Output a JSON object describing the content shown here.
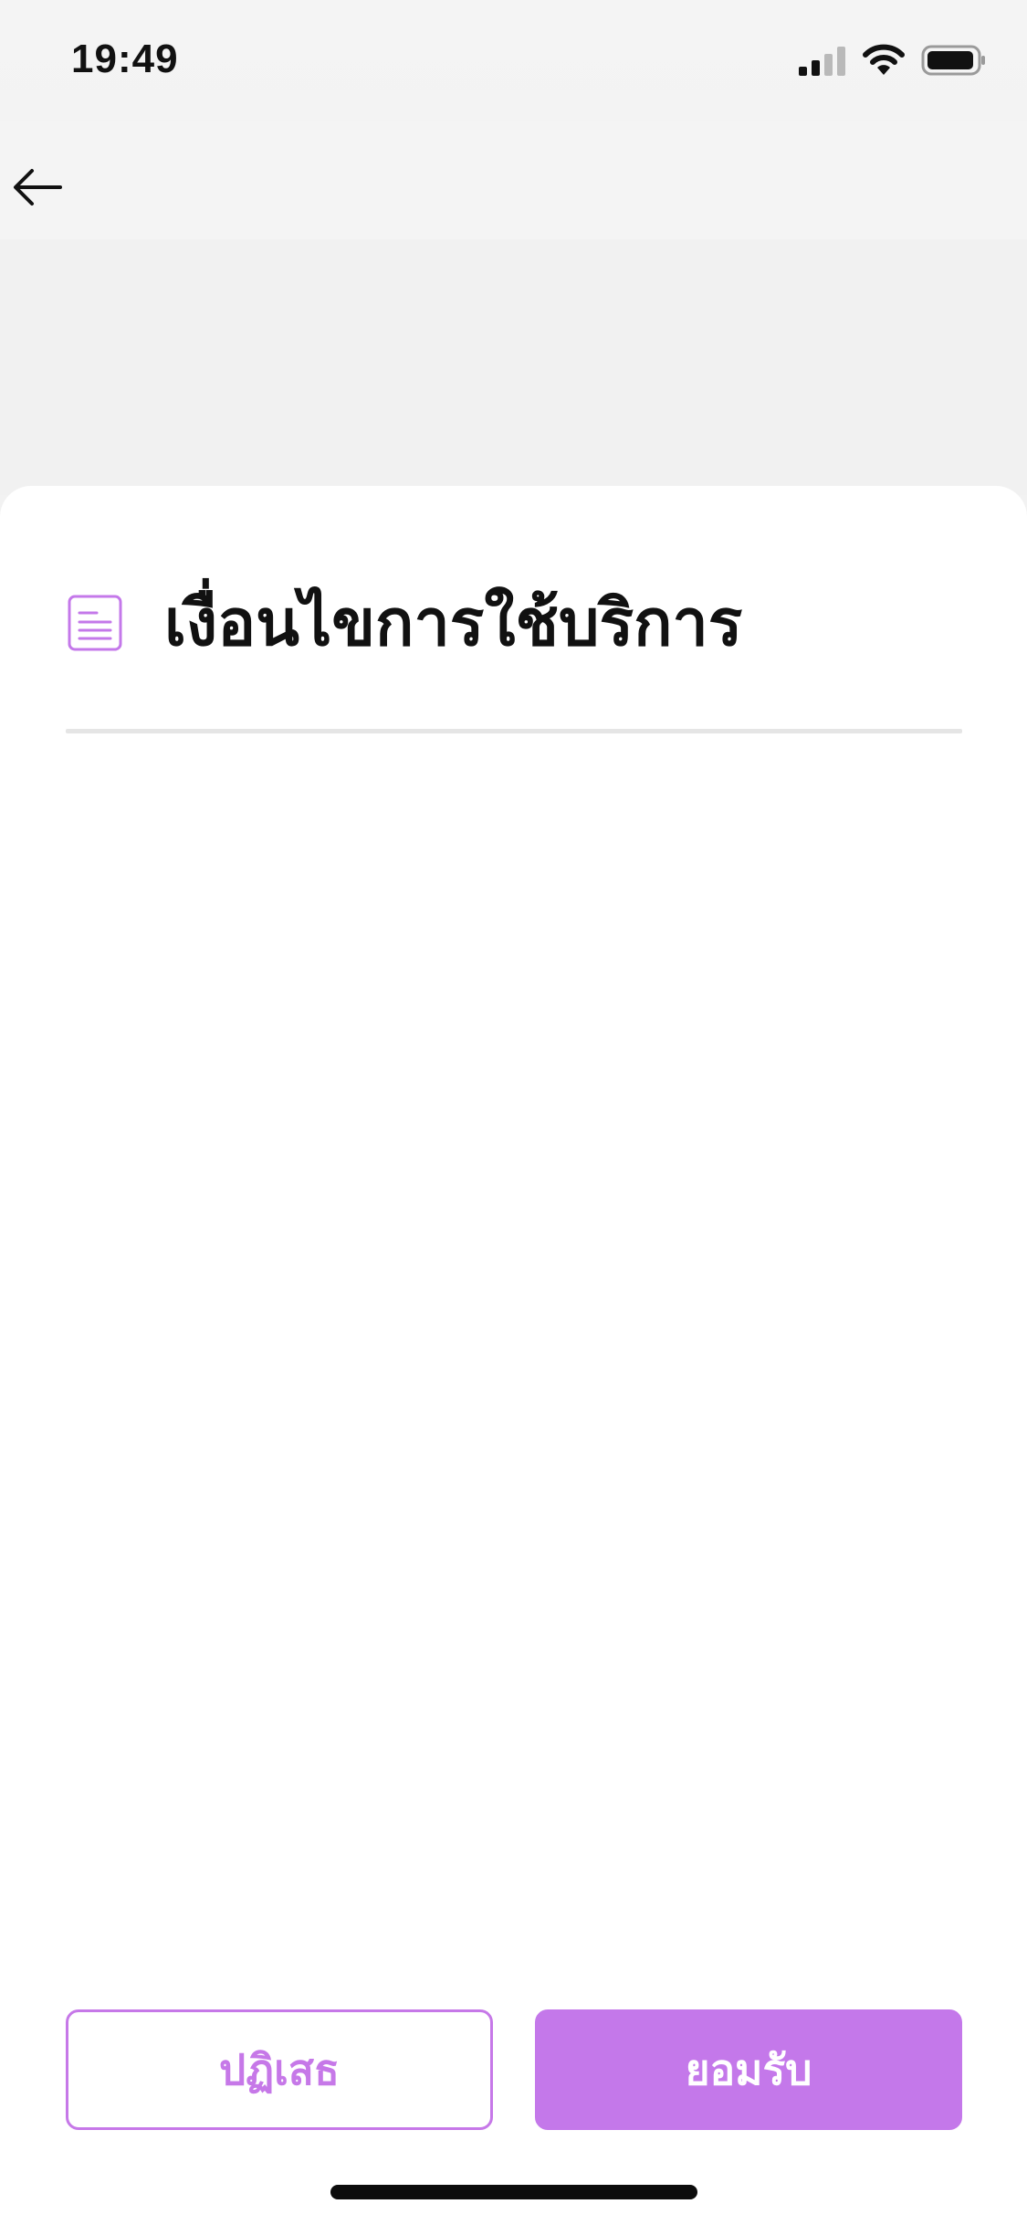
{
  "status_bar": {
    "time": "19:49",
    "signal_icon": "cellular-signal-icon",
    "wifi_icon": "wifi-icon",
    "battery_icon": "battery-icon"
  },
  "nav": {
    "back_icon": "arrow-left-icon"
  },
  "sheet": {
    "icon": "document-icon",
    "title": "เงื่อนไขการใช้บริการ"
  },
  "actions": {
    "decline_label": "ปฏิเสธ",
    "accept_label": "ยอมรับ"
  },
  "colors": {
    "accent": "#c478ea",
    "background": "#f2f2f2",
    "sheet": "#ffffff",
    "text": "#111111"
  }
}
